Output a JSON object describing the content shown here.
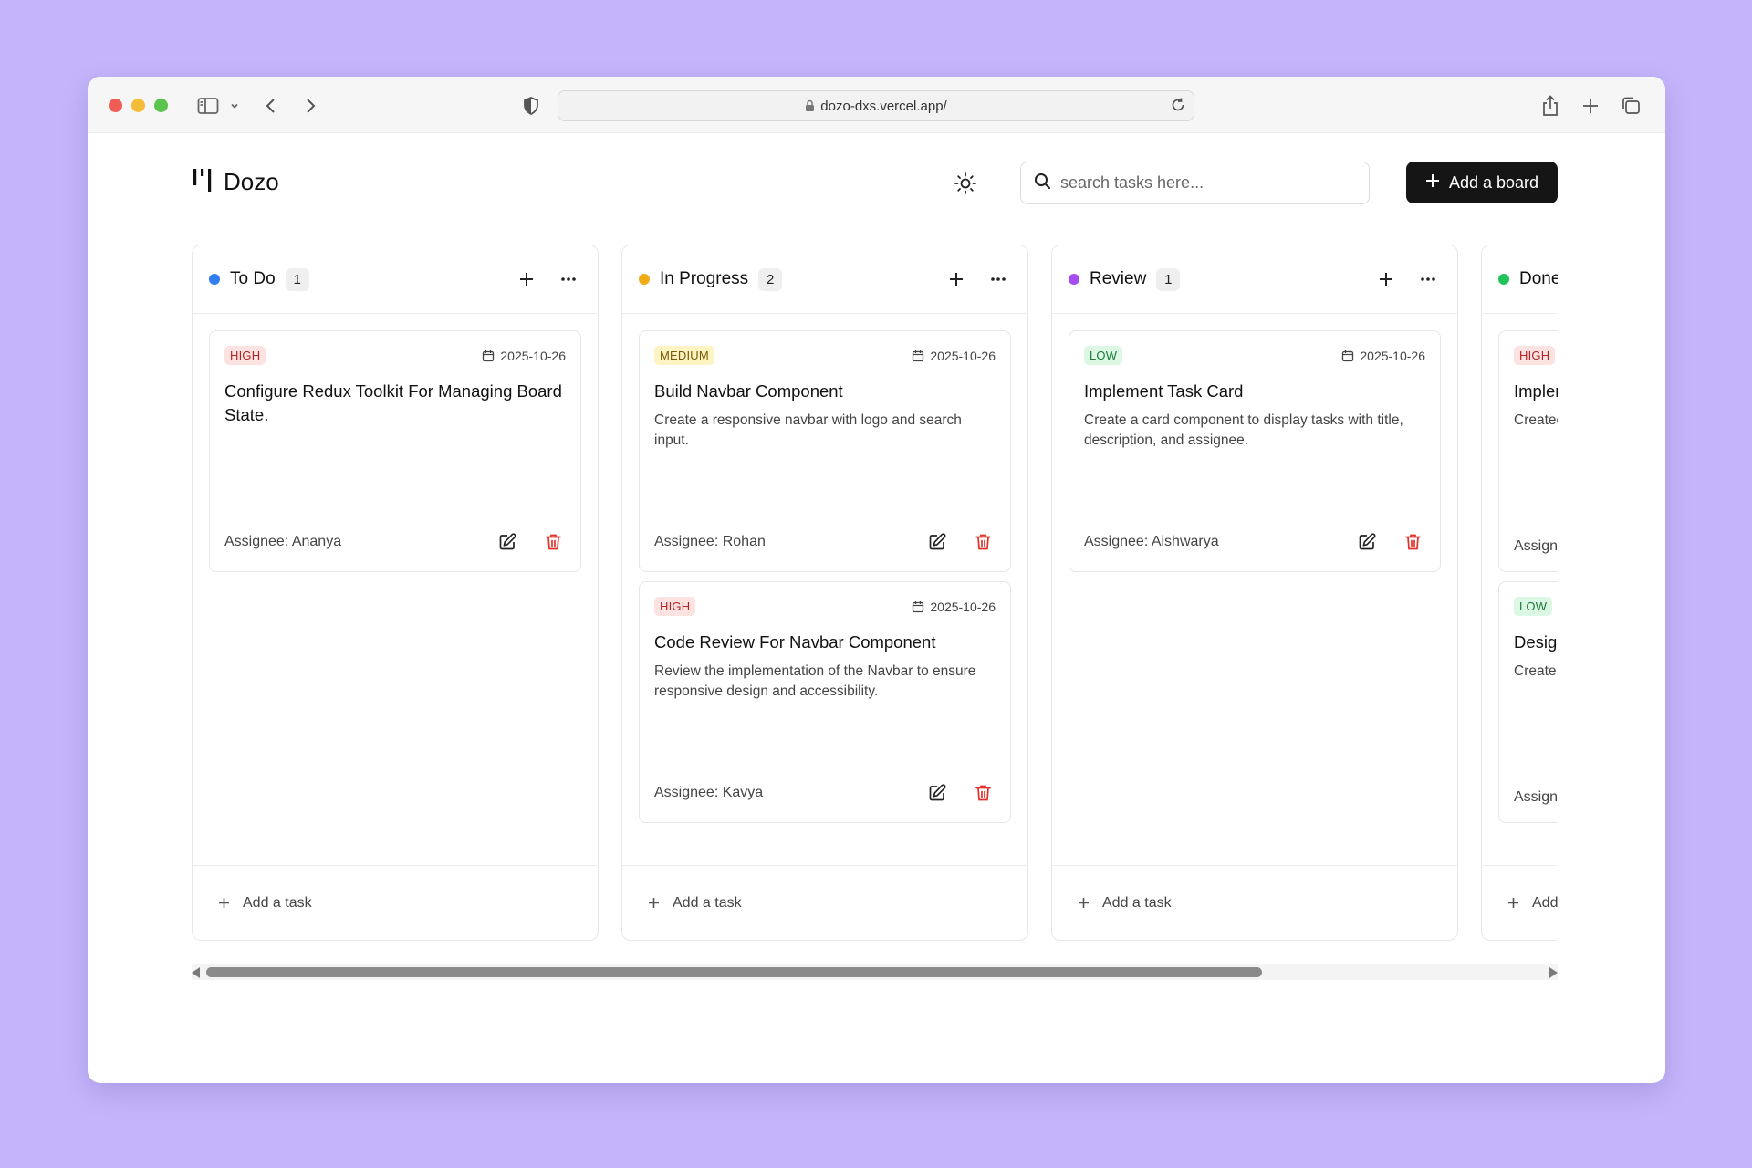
{
  "browser": {
    "url": "dozo-dxs.vercel.app/"
  },
  "app": {
    "name": "Dozo",
    "search_placeholder": "search tasks here...",
    "add_board_label": "Add a board"
  },
  "columns": [
    {
      "title": "To Do",
      "count": "1",
      "color": "#2f7ff0",
      "add_task_label": "Add a task",
      "cards": [
        {
          "priority": "HIGH",
          "priority_level": "high",
          "date": "2025-10-26",
          "title": "Configure Redux Toolkit For Managing Board State.",
          "description": "",
          "assignee": "Assignee: Ananya"
        }
      ]
    },
    {
      "title": "In Progress",
      "count": "2",
      "color": "#f0ac17",
      "add_task_label": "Add a task",
      "cards": [
        {
          "priority": "MEDIUM",
          "priority_level": "medium",
          "date": "2025-10-26",
          "title": "Build Navbar Component",
          "description": "Create a responsive navbar with logo and search input.",
          "assignee": "Assignee: Rohan"
        },
        {
          "priority": "HIGH",
          "priority_level": "high",
          "date": "2025-10-26",
          "title": "Code Review For Navbar Component",
          "description": "Review the implementation of the Navbar to ensure responsive design and accessibility.",
          "assignee": "Assignee: Kavya"
        }
      ]
    },
    {
      "title": "Review",
      "count": "1",
      "color": "#a64df0",
      "add_task_label": "Add a task",
      "cards": [
        {
          "priority": "LOW",
          "priority_level": "low",
          "date": "2025-10-26",
          "title": "Implement Task Card",
          "description": "Create a card component to display tasks with title, description, and assignee.",
          "assignee": "Assignee: Aishwarya"
        }
      ]
    },
    {
      "title": "Done",
      "count": "",
      "color": "#22c25a",
      "add_task_label": "Add a task",
      "cards": [
        {
          "priority": "HIGH",
          "priority_level": "high",
          "date": "",
          "title": "Implen",
          "description": "Createc validati endpoir",
          "assignee": "Assigne"
        },
        {
          "priority": "LOW",
          "priority_level": "low",
          "date": "",
          "title": "Desigr",
          "description": "Create landing",
          "assignee": "Assigne"
        }
      ]
    }
  ],
  "scrollbar": {
    "thumb_fraction": 0.79
  }
}
